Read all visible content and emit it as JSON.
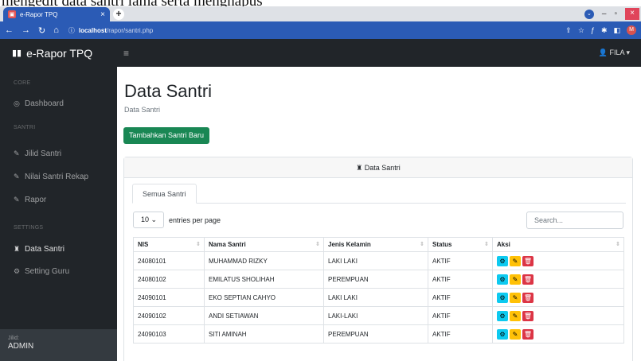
{
  "caption": {
    "text": "mengedit data santri lama serta menghapus"
  },
  "browser": {
    "tab_title": "e-Rapor TPQ",
    "url_host": "localhost",
    "url_path": "/rapor/santri.php"
  },
  "navbar": {
    "brand": "e-Rapor TPQ",
    "user": "FILA"
  },
  "sidebar": {
    "headings": [
      "CORE",
      "SANTRI",
      "SETTINGS"
    ],
    "items": [
      {
        "label": "Dashboard",
        "icon": "gauge-icon"
      },
      {
        "label": "Jilid Santri",
        "icon": "edit-icon"
      },
      {
        "label": "Nilai Santri Rekap",
        "icon": "edit-icon"
      },
      {
        "label": "Rapor",
        "icon": "edit-icon"
      },
      {
        "label": "Data Santri",
        "icon": "user-tie-icon"
      },
      {
        "label": "Setting Guru",
        "icon": "users-gear-icon"
      }
    ],
    "footer_label": "Jilid:",
    "footer_user": "ADMIN"
  },
  "main": {
    "title": "Data Santri",
    "breadcrumb": "Data Santri",
    "add_button": "Tambahkan Santri Baru",
    "card_title": "Data Santri",
    "tab_label": "Semua Santri",
    "entries_value": "10",
    "entries_suffix": "entries per page",
    "search_placeholder": "Search..."
  },
  "table": {
    "columns": [
      "NIS",
      "Nama Santri",
      "Jenis Kelamin",
      "Status",
      "Aksi"
    ],
    "rows": [
      [
        "24080101",
        "MUHAMMAD RIZKY",
        "LAKI LAKI",
        "AKTIF"
      ],
      [
        "24080102",
        "EMILATUS SHOLIHAH",
        "PEREMPUAN",
        "AKTIF"
      ],
      [
        "24090101",
        "EKO SEPTIAN CAHYO",
        "LAKI LAKI",
        "AKTIF"
      ],
      [
        "24090102",
        "ANDI SETIAWAN",
        "LAKI-LAKI",
        "AKTIF"
      ],
      [
        "24090103",
        "SITI AMINAH",
        "PEREMPUAN",
        "AKTIF"
      ]
    ]
  },
  "colors": {
    "sidebar_bg": "#212529",
    "browser_blue": "#2b5bb5",
    "success": "#198754",
    "info": "#0dcaf0",
    "warning": "#ffc107",
    "danger": "#dc3545"
  }
}
